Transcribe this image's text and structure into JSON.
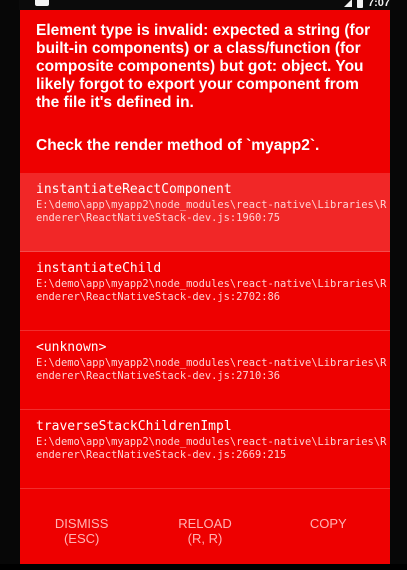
{
  "status_bar": {
    "time": "7:07"
  },
  "error": {
    "message": "Element type is invalid: expected a string (for built-in components) or a class/function (for composite components) but got: object. You likely forgot to export your component from the file it's defined in.",
    "hint": "Check the render method of `myapp2`."
  },
  "stack": [
    {
      "method": "instantiateReactComponent",
      "location": "E:\\demo\\app\\myapp2\\node_modules\\react-native\\Libraries\\Renderer\\ReactNativeStack-dev.js:1960:75"
    },
    {
      "method": "instantiateChild",
      "location": "E:\\demo\\app\\myapp2\\node_modules\\react-native\\Libraries\\Renderer\\ReactNativeStack-dev.js:2702:86"
    },
    {
      "method": "<unknown>",
      "location": "E:\\demo\\app\\myapp2\\node_modules\\react-native\\Libraries\\Renderer\\ReactNativeStack-dev.js:2710:36"
    },
    {
      "method": "traverseStackChildrenImpl",
      "location": "E:\\demo\\app\\myapp2\\node_modules\\react-native\\Libraries\\Renderer\\ReactNativeStack-dev.js:2669:215"
    }
  ],
  "buttons": {
    "dismiss_label": "DISMISS",
    "dismiss_shortcut": "(ESC)",
    "reload_label": "RELOAD",
    "reload_shortcut": "(R, R)",
    "copy_label": "COPY"
  },
  "colors": {
    "background": "#ee0000",
    "button_text": "#ffb3b3"
  }
}
